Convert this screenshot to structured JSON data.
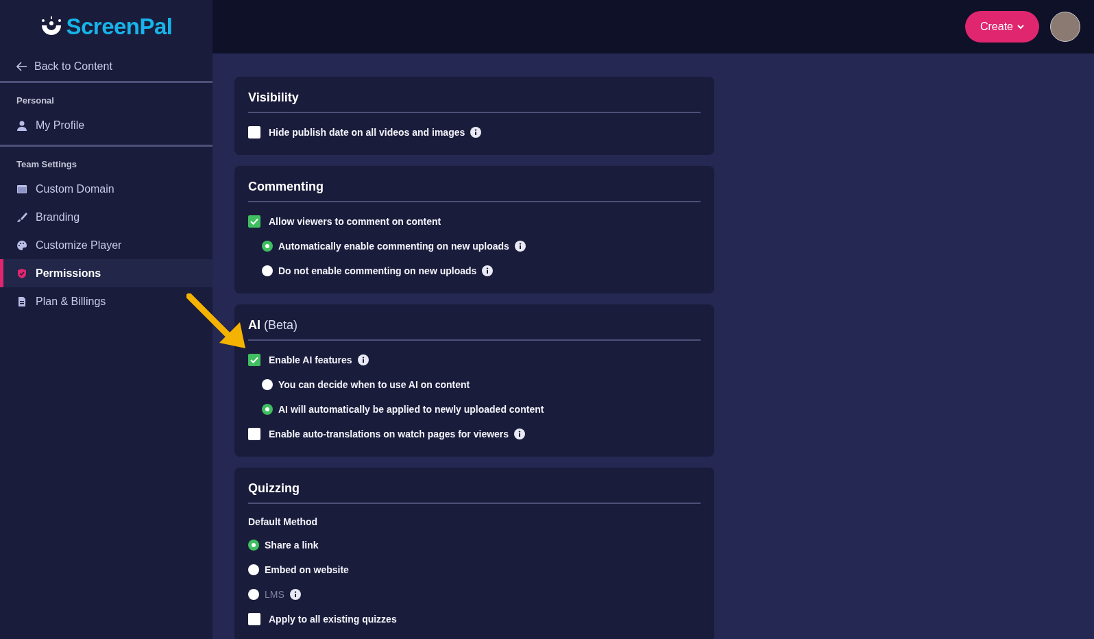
{
  "sidebar": {
    "logo": "ScreenPal",
    "back": "Back to Content",
    "groups": [
      {
        "heading": "Personal",
        "items": [
          {
            "label": "My Profile",
            "selected": false
          }
        ]
      },
      {
        "heading": "Team Settings",
        "items": [
          {
            "label": "Custom Domain",
            "selected": false
          },
          {
            "label": "Branding",
            "selected": false
          },
          {
            "label": "Customize Player",
            "selected": false
          },
          {
            "label": "Permissions",
            "selected": true
          },
          {
            "label": "Plan & Billings",
            "selected": false
          }
        ]
      }
    ]
  },
  "header": {
    "create_button": "Create"
  },
  "sections": [
    {
      "title": "Visibility",
      "items": [
        {
          "kind": "checkbox",
          "label": "Hide publish date on all videos and images",
          "checked": false,
          "info": true
        }
      ]
    },
    {
      "title": "Commenting",
      "items": [
        {
          "kind": "checkbox",
          "label": "Allow viewers to comment on content",
          "checked": true,
          "info": false,
          "children": [
            {
              "kind": "radio",
              "label": "Automatically enable commenting on new uploads",
              "selected": true,
              "info": true
            },
            {
              "kind": "radio",
              "label": "Do not enable commenting on new uploads",
              "selected": false,
              "info": true
            }
          ]
        }
      ]
    },
    {
      "title": "AI",
      "note": "(Beta)",
      "items": [
        {
          "kind": "checkbox",
          "label": "Enable AI features",
          "checked": true,
          "info": true,
          "children": [
            {
              "kind": "radio",
              "label": "You can decide when to use AI on content",
              "selected": false,
              "info": false
            },
            {
              "kind": "radio",
              "label": "AI will automatically be applied to newly uploaded content",
              "selected": true,
              "info": false
            }
          ]
        },
        {
          "kind": "checkbox",
          "label": "Enable auto-translations on watch pages for viewers",
          "checked": false,
          "info": true
        }
      ]
    },
    {
      "title": "Quizzing",
      "items": [
        {
          "kind": "subheading",
          "label": "Default Method"
        },
        {
          "kind": "radio",
          "label": "Share a link",
          "selected": true,
          "info": false,
          "disabled": false
        },
        {
          "kind": "radio",
          "label": "Embed on website",
          "selected": false,
          "info": false,
          "disabled": false
        },
        {
          "kind": "radio",
          "label": "LMS",
          "selected": false,
          "info": true,
          "disabled": true
        },
        {
          "kind": "checkbox",
          "label": "Apply to all existing quizzes",
          "checked": false,
          "info": false
        }
      ]
    }
  ]
}
